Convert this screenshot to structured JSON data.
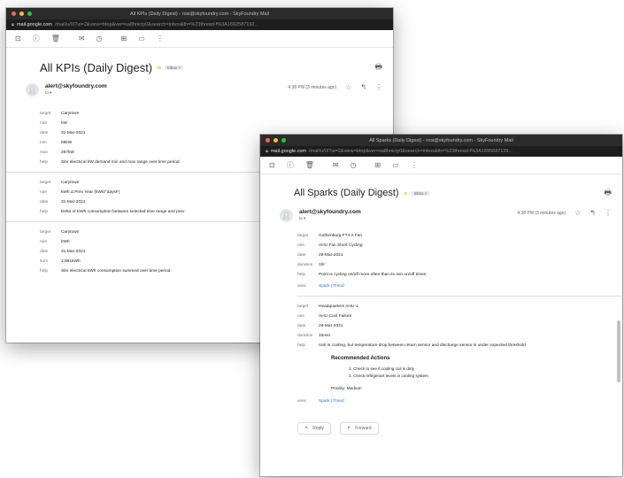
{
  "colors": {
    "red": "#fe5f57",
    "yellow": "#febc2e",
    "green": "#28c840",
    "link": "#1a73e8",
    "important": "#f4b400"
  },
  "kpi_window": {
    "title_bar": "All KPIs (Daily Digest) - rosi@skyfoundry.com - SkyFoundry Mail",
    "url_host": "mail.google.com",
    "url_path": "/mail/u/0/?ui=2&view=btop&ver=sa8hnicty0&search=inbox&th=%23thread-f%3A1692587192...",
    "toolbar_icons": [
      "archive-icon",
      "spam-icon",
      "delete-icon",
      "mail-icon",
      "clock-icon",
      "move-icon",
      "label-icon",
      "more-icon"
    ],
    "subject": "All KPIs (Daily Digest)",
    "inbox_label": "Inbox ×",
    "sender": "alert@skyfoundry.com",
    "to": "to ▾",
    "time": "4:38 PM (3 minutes ago)",
    "blocks": [
      {
        "rows": [
          {
            "k": "target",
            "v": "Carytown"
          },
          {
            "k": "rule",
            "v": "kW"
          },
          {
            "k": "date",
            "v": "31-Mar-2021"
          },
          {
            "k": "min",
            "v": "86kW"
          },
          {
            "k": "max",
            "v": "257kW"
          },
          {
            "k": "help",
            "v": "Site electrical kW demand min and max range over time period."
          }
        ]
      },
      {
        "rows": [
          {
            "k": "target",
            "v": "Carytown"
          },
          {
            "k": "rule",
            "v": "kWh Δ Prev Year (kWh/°daysF)"
          },
          {
            "k": "date",
            "v": "31-Mar-2021"
          },
          {
            "k": "help",
            "v": "Delta of KWh consumption between selected time range and prev"
          }
        ]
      },
      {
        "rows": [
          {
            "k": "target",
            "v": "Carytown"
          },
          {
            "k": "rule",
            "v": "kWh"
          },
          {
            "k": "date",
            "v": "31-Mar-2021"
          },
          {
            "k": "sum",
            "v": "1,881kWh"
          },
          {
            "k": "help",
            "v": "Site electrical kWh consumption summed over time period."
          }
        ]
      }
    ]
  },
  "sparks_window": {
    "title_bar": "All Sparks (Daily Digest) - rosi@skyfoundry.com - SkyFoundry Mail",
    "url_host": "mail.google.com",
    "url_path": "/mail/u/0/?ui=2&view=btop&ver=sa8hnicty0&search=inbox&th=%23thread-f%3A1695687129...",
    "toolbar_icons": [
      "archive-icon",
      "spam-icon",
      "delete-icon",
      "mail-icon",
      "clock-icon",
      "move-icon",
      "label-icon",
      "more-icon"
    ],
    "subject": "All Sparks (Daily Digest)",
    "inbox_label": "Inbox ×",
    "sender": "alert@skyfoundry.com",
    "to": "to ▾",
    "time": "4:38 PM (3 minutes ago)",
    "block1": [
      {
        "k": "target",
        "v": "Gothenburg FT4-2 Fan"
      },
      {
        "k": "rule",
        "v": "AHU Fan Short Cycling"
      },
      {
        "k": "date",
        "v": "29-Mar-2021"
      },
      {
        "k": "duration",
        "v": "1hr"
      },
      {
        "k": "help",
        "v": "Point is cycling on/off more often than its min on/off times."
      }
    ],
    "block1_view_key": "view",
    "block1_view": "Spark | Trend",
    "block2": [
      {
        "k": "target",
        "v": "Headquarters AHU-1"
      },
      {
        "k": "rule",
        "v": "AHU Cool Failure"
      },
      {
        "k": "date",
        "v": "29-Mar-2021"
      },
      {
        "k": "duration",
        "v": "15min"
      },
      {
        "k": "help",
        "v": "Unit is cooling, but temperature drop between return sensor and discharge sensor is under expected threshold."
      }
    ],
    "recommended_title": "Recommended Actions",
    "actions": [
      "1. Check to see if cooling coil is dirty",
      "2. Check refrigerant levels in cooling system"
    ],
    "priority": "Priority: Medium",
    "block2_view_key": "view",
    "block2_view": "Spark | Trend",
    "reply": "Reply",
    "forward": "Forward"
  }
}
